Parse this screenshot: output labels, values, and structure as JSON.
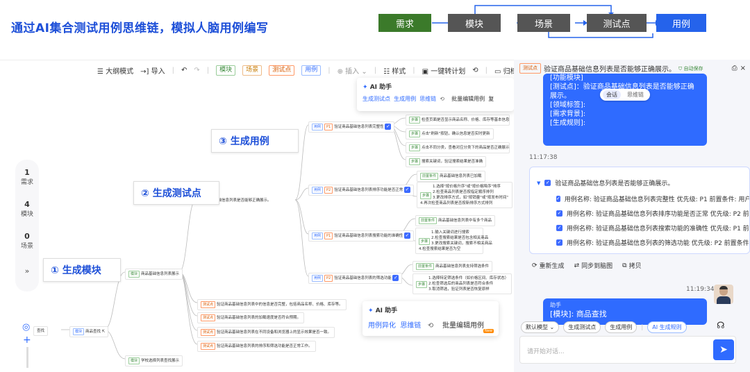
{
  "header": {
    "title": "通过AI集合测试用例思维链，模拟人脑用例编写",
    "flow": [
      {
        "label": "需求",
        "color": "#3b7a2a"
      },
      {
        "label": "模块",
        "color": "#555555"
      },
      {
        "label": "场景",
        "color": "#555555"
      },
      {
        "label": "测试点",
        "color": "#555555"
      },
      {
        "label": "用例",
        "color": "#2563eb"
      }
    ]
  },
  "toolbar": {
    "outline": "大纲模式",
    "import": "导入",
    "tags": [
      "模块",
      "场景",
      "测试点",
      "用例"
    ],
    "insert": "插入",
    "style": "样式",
    "plan": "一键转计划",
    "archive": "归档用(",
    "selected_tag": "测试点",
    "selected_title": "验证商品基础信息列表是否能够正确展示。",
    "autosave": "自动保存"
  },
  "left_panel": {
    "items": [
      {
        "num": "1",
        "label": "需求"
      },
      {
        "num": "4",
        "label": "模块"
      },
      {
        "num": "0",
        "label": "场景"
      }
    ],
    "collapse": "»"
  },
  "steps": {
    "s1": "① 生成模块",
    "s2": "② 生成测试点",
    "s3": "③ 生成用例"
  },
  "mindmap": {
    "root": "商品查找",
    "root_prefix": "查找",
    "module1": "商品基础信息列表展示",
    "module2": "学校选择列表查找展示",
    "module_tag": "模块",
    "tp_main": "验证商品基础信息列表是否能够正确展示。",
    "cases": [
      "验证商品基础信息列表完整性",
      "验证商品基础信息列表排序功能是否正常",
      "验证商品基础信息列表搜索功能的准确性",
      "验证商品基础信息列表的筛选功能"
    ],
    "case_tag": "用例",
    "priorities": [
      "P1",
      "P2",
      "P1",
      "P2"
    ],
    "steps_c1": [
      "检查页面是否显示商品名称、价格、库存等基本信息",
      "点击\"刷新\"按钮，确认信息是否实时更新",
      "点击不同分类，查看对应分类下的商品是否正确展示",
      "搜索关键词，验证搜索结果是否准确"
    ],
    "c2_pre": "商品基础信息列表已加载",
    "c2_steps": "1.选择\"按价格升序\"或\"按价格降序\"排序\n2.检查商品列表是否按指定顺序排列\n3.更改排序方式，如\"按销量\"或\"按发布时间\"\n4.再次检查商品列表是否按新排序方式排列",
    "c3_pre": "商品基础信息列表中有多个商品",
    "c3_steps": "1.输入关键词进行搜索\n2.检查搜索结果是否包含相关商品\n3.更改搜索关键词，搜索不相关商品\n4.检查搜索结果是否为空",
    "c4_pre": "商品基础信息列表支持筛选条件",
    "c4_steps": "1.选择特定筛选条件（如价格区间、库存状态）\n2.检查筛选后的商品列表是否符合条件\n3.取消筛选，验证列表是否恢复原样",
    "pre_tag": "前置条件",
    "step_tag": "步骤",
    "tp_tag": "测试点",
    "testpoints": [
      "验证商品基础信息列表中的信息是否完整，包括商品名称、价格、库存等。",
      "验证商品基础信息列表的加载速度是否符合预期。",
      "验证商品基础信息列表在不同设备和浏览器上的显示效果是否一致。",
      "验证商品基础信息列表的排序和筛选功能是否正常工作。"
    ]
  },
  "ai_popup1": {
    "title": "AI 助手",
    "tabs": [
      "生成测试点",
      "生成用例",
      "思维链"
    ],
    "batch": "批量编辑用例",
    "more": "复"
  },
  "ai_popup2": {
    "title": "AI 助手",
    "tabs": [
      "用例异化",
      "思维链"
    ],
    "batch": "批量编辑用例",
    "badge": "New"
  },
  "chat": {
    "bubble1_lines": [
      "[功能模块]",
      "[测试点]：验证商品基础信息列表是否能够正确展示。",
      "[领域标签]:",
      "[需求背景]:",
      "[生成规则]:"
    ],
    "toggle": [
      "会话",
      "思维链"
    ],
    "time1": "11:17:38",
    "card_title": "验证商品基础信息列表是否能够正确展示。",
    "card_cases": [
      "用例名称: 验证商品基础信息列表完整性 优先级: P1 前置条件: 用户",
      "用例名称: 验证商品基础信息列表排序功能是否正常 优先级: P2 前",
      "用例名称: 验证商品基础信息列表搜索功能的准确性 优先级: P1 前",
      "用例名称: 验证商品基础信息列表的筛选功能 优先级: P2 前置条件"
    ],
    "actions": [
      "重新生成",
      "同步到脑图",
      "拷贝"
    ],
    "time2": "11:19:34",
    "assistant_label": "助手",
    "bubble2": "[模块]: 商品查找",
    "model": "默认模型",
    "quick": [
      "生成测试点",
      "生成用例"
    ],
    "ai_rule": "AI 生成规则",
    "placeholder": "请开始对话..."
  }
}
